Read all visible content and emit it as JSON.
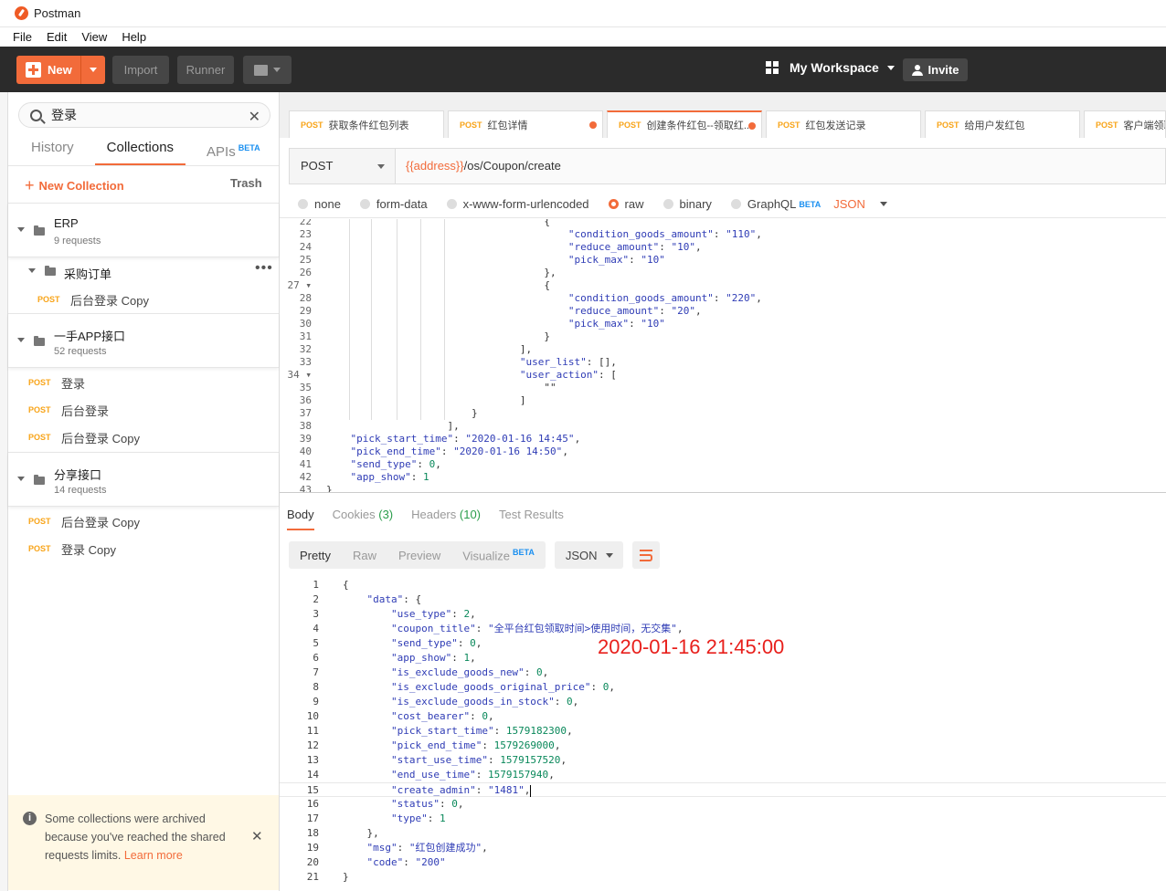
{
  "window": {
    "title": "Postman"
  },
  "menu": [
    "File",
    "Edit",
    "View",
    "Help"
  ],
  "toolbar": {
    "new": "New",
    "import": "Import",
    "runner": "Runner",
    "workspace": "My Workspace",
    "invite": "Invite"
  },
  "sidebar": {
    "search_value": "登录",
    "tabs": {
      "history": "History",
      "collections": "Collections",
      "apis": "APIs",
      "beta": "BETA"
    },
    "new_collection": "New Collection",
    "trash": "Trash",
    "collections": [
      {
        "name": "ERP",
        "count": "9 requests"
      },
      {
        "name": "一手APP接口",
        "count": "52 requests"
      },
      {
        "name": "分享接口",
        "count": "14 requests"
      }
    ],
    "folder": {
      "name": "采购订单"
    },
    "requests": [
      {
        "method": "POST",
        "name": "后台登录 Copy"
      },
      {
        "method": "POST",
        "name": "登录"
      },
      {
        "method": "POST",
        "name": "后台登录"
      },
      {
        "method": "POST",
        "name": "后台登录 Copy"
      },
      {
        "method": "POST",
        "name": "后台登录 Copy"
      },
      {
        "method": "POST",
        "name": "登录 Copy"
      }
    ],
    "archived": {
      "msg": "Some collections were archived because you've reached the shared requests limits.",
      "learn": "Learn more"
    }
  },
  "tabs": [
    {
      "method": "POST",
      "name": "获取条件红包列表"
    },
    {
      "method": "POST",
      "name": "红包详情"
    },
    {
      "method": "POST",
      "name": "创建条件红包--领取红..."
    },
    {
      "method": "POST",
      "name": "红包发送记录"
    },
    {
      "method": "POST",
      "name": "给用户发红包"
    },
    {
      "method": "POST",
      "name": "客户端领取"
    }
  ],
  "request": {
    "method": "POST",
    "url_var": "{{address}}",
    "url_path": "/os/Coupon/create",
    "body_types": [
      "none",
      "form-data",
      "x-www-form-urlencoded",
      "raw",
      "binary",
      "GraphQL"
    ],
    "graphql_beta": "BETA",
    "format": "JSON"
  },
  "editor_lines": [
    {
      "n": "22",
      "t": "                                    {"
    },
    {
      "n": "23",
      "t": "                                        \"condition_goods_amount\": \"110\","
    },
    {
      "n": "24",
      "t": "                                        \"reduce_amount\": \"10\","
    },
    {
      "n": "25",
      "t": "                                        \"pick_max\": \"10\""
    },
    {
      "n": "26",
      "t": "                                    },"
    },
    {
      "n": "27 ▾",
      "t": "                                    {"
    },
    {
      "n": "28",
      "t": "                                        \"condition_goods_amount\": \"220\","
    },
    {
      "n": "29",
      "t": "                                        \"reduce_amount\": \"20\","
    },
    {
      "n": "30",
      "t": "                                        \"pick_max\": \"10\""
    },
    {
      "n": "31",
      "t": "                                    }"
    },
    {
      "n": "32",
      "t": "                                ],"
    },
    {
      "n": "33",
      "t": "                                \"user_list\": [],"
    },
    {
      "n": "34 ▾",
      "t": "                                \"user_action\": ["
    },
    {
      "n": "35",
      "t": "                                    \"\""
    },
    {
      "n": "36",
      "t": "                                ]"
    },
    {
      "n": "37",
      "t": "                        }"
    },
    {
      "n": "38",
      "t": "                    ],"
    },
    {
      "n": "39",
      "t": "    \"pick_start_time\": \"2020-01-16 14:45\","
    },
    {
      "n": "40",
      "t": "    \"pick_end_time\": \"2020-01-16 14:50\","
    },
    {
      "n": "41",
      "t": "    \"send_type\": 0,"
    },
    {
      "n": "42",
      "t": "    \"app_show\": 1"
    },
    {
      "n": "43",
      "t": "}"
    }
  ],
  "response_tabs": {
    "body": "Body",
    "cookies": "Cookies",
    "cookies_n": "(3)",
    "headers": "Headers",
    "headers_n": "(10)",
    "tests": "Test Results"
  },
  "response_bar": {
    "pretty": "Pretty",
    "raw": "Raw",
    "preview": "Preview",
    "visualize": "Visualize",
    "beta": "BETA",
    "format": "JSON"
  },
  "response_lines": [
    {
      "n": "1",
      "t": "{"
    },
    {
      "n": "2",
      "t": "    \"data\": {"
    },
    {
      "n": "3",
      "t": "        \"use_type\": 2,"
    },
    {
      "n": "4",
      "t": "        \"coupon_title\": \"全平台红包领取时间>使用时间，无交集\","
    },
    {
      "n": "5",
      "t": "        \"send_type\": 0,"
    },
    {
      "n": "6",
      "t": "        \"app_show\": 1,"
    },
    {
      "n": "7",
      "t": "        \"is_exclude_goods_new\": 0,"
    },
    {
      "n": "8",
      "t": "        \"is_exclude_goods_original_price\": 0,"
    },
    {
      "n": "9",
      "t": "        \"is_exclude_goods_in_stock\": 0,"
    },
    {
      "n": "10",
      "t": "        \"cost_bearer\": 0,"
    },
    {
      "n": "11",
      "t": "        \"pick_start_time\": 1579182300,"
    },
    {
      "n": "12",
      "t": "        \"pick_end_time\": 1579269000,"
    },
    {
      "n": "13",
      "t": "        \"start_use_time\": 1579157520,"
    },
    {
      "n": "14",
      "t": "        \"end_use_time\": 1579157940,"
    },
    {
      "n": "15",
      "t": "        \"create_admin\": \"1481\","
    },
    {
      "n": "16",
      "t": "        \"status\": 0,"
    },
    {
      "n": "17",
      "t": "        \"type\": 1"
    },
    {
      "n": "18",
      "t": "    },"
    },
    {
      "n": "19",
      "t": "    \"msg\": \"红包创建成功\","
    },
    {
      "n": "20",
      "t": "    \"code\": \"200\""
    },
    {
      "n": "21",
      "t": "}"
    }
  ],
  "annotation": "2020-01-16 21:45:00",
  "colors": {
    "accent": "#f26b3a",
    "post": "#f8a419",
    "toolbar": "#2b2b2b"
  }
}
